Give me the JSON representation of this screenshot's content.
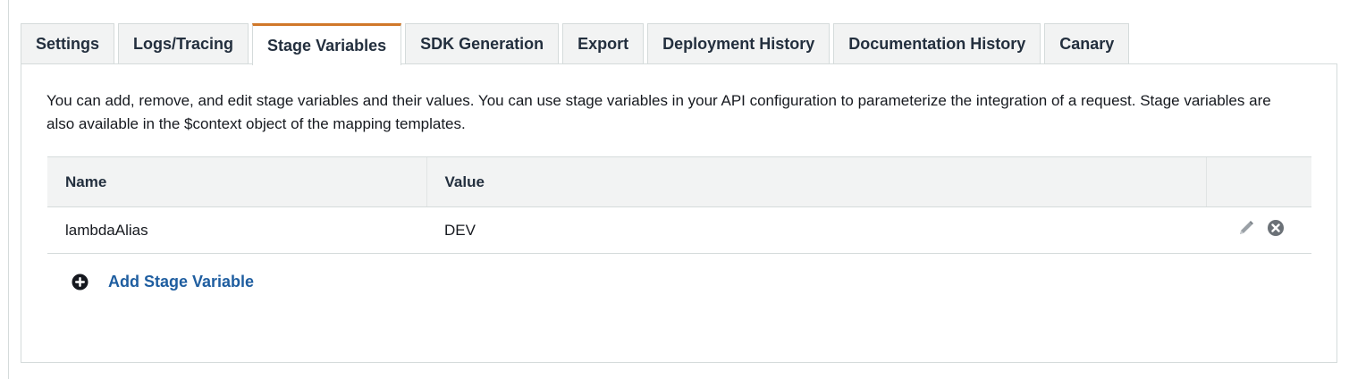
{
  "tabs": [
    {
      "label": "Settings",
      "active": false
    },
    {
      "label": "Logs/Tracing",
      "active": false
    },
    {
      "label": "Stage Variables",
      "active": true
    },
    {
      "label": "SDK Generation",
      "active": false
    },
    {
      "label": "Export",
      "active": false
    },
    {
      "label": "Deployment History",
      "active": false
    },
    {
      "label": "Documentation History",
      "active": false
    },
    {
      "label": "Canary",
      "active": false
    }
  ],
  "description": "You can add, remove, and edit stage variables and their values. You can use stage variables in your API configuration to parameterize the integration of a request. Stage variables are also available in the $context object of the mapping templates.",
  "table": {
    "headers": {
      "name": "Name",
      "value": "Value"
    },
    "rows": [
      {
        "name": "lambdaAlias",
        "value": "DEV",
        "actions": [
          "pencil-icon",
          "close-circle-icon"
        ]
      }
    ]
  },
  "add_button": {
    "label": "Add Stage Variable",
    "icon": "plus-circle-icon"
  },
  "colors": {
    "active_tab_accent": "#d0782a",
    "link": "#1f5ea0",
    "tab_background": "#f2f3f3",
    "border": "#d5dbdb"
  }
}
